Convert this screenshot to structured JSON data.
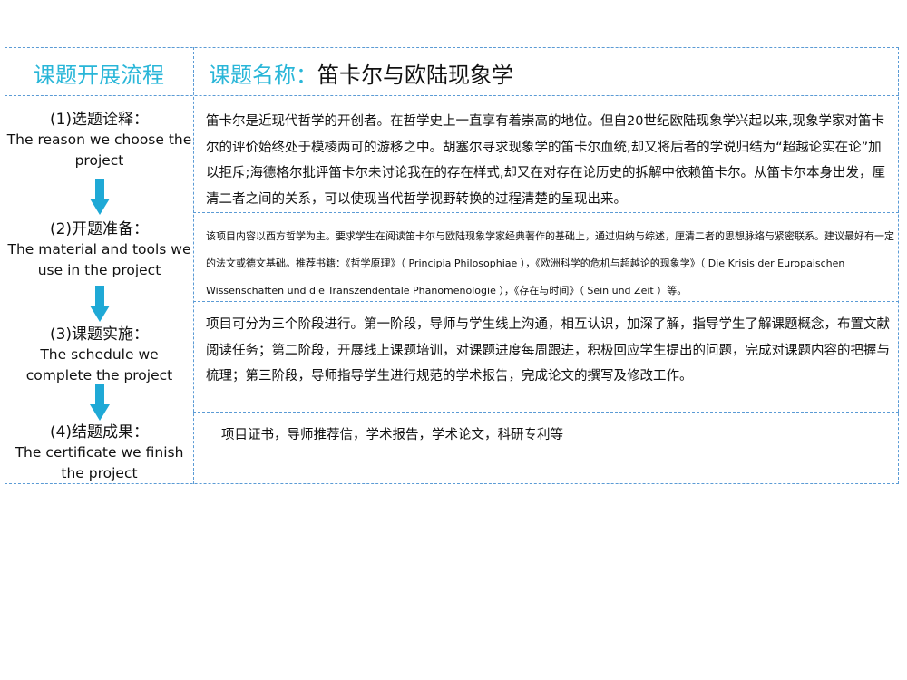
{
  "header": {
    "left_title": "课题开展流程",
    "right_label": "课题名称：",
    "right_title": "笛卡尔与欧陆现象学"
  },
  "steps": [
    {
      "cn": "(1)选题诠释：",
      "en": "The reason we choose the project"
    },
    {
      "cn": "(2)开题准备：",
      "en": "The material and tools we use in the project"
    },
    {
      "cn": "(3)课题实施：",
      "en": "The schedule we complete the project"
    },
    {
      "cn": "(4)结题成果：",
      "en": "The certificate we finish the project"
    }
  ],
  "contents": [
    "笛卡尔是近现代哲学的开创者。在哲学史上一直享有着崇高的地位。但自20世纪欧陆现象学兴起以来,现象学家对笛卡尔的评价始终处于模棱两可的游移之中。胡塞尔寻求现象学的笛卡尔血统,却又将后者的学说归结为“超越论实在论”加以拒斥;海德格尔批评笛卡尔未讨论我在的存在样式,却又在对存在论历史的拆解中依赖笛卡尔。从笛卡尔本身出发，厘清二者之间的关系，可以使现当代哲学视野转换的过程清楚的呈现出来。",
    "该项目内容以西方哲学为主。要求学生在阅读笛卡尔与欧陆现象学家经典著作的基础上，通过归纳与综述，厘清二者的思想脉络与紧密联系。建议最好有一定的法文或德文基础。推荐书籍：《哲学原理》（ Principia Philosophiae ），《欧洲科学的危机与超越论的现象学》（  Die Krisis der Europaischen Wissenschaften und die Transzendentale Phanomenologie ），《存在与时间》（ Sein und Zeit ）等。",
    "项目可分为三个阶段进行。第一阶段，导师与学生线上沟通，相互认识，加深了解，指导学生了解课题概念，布置文献阅读任务；第二阶段，开展线上课题培训，对课题进度每周跟进，积极回应学生提出的问题，完成对课题内容的把握与梳理；第三阶段，导师指导学生进行规范的学术报告，完成论文的撰写及修改工作。",
    "项目证书，导师推荐信，学术报告，学术论文，科研专利等"
  ],
  "colors": {
    "accent": "#29b6d8",
    "border": "#5b9bd5",
    "arrow": "#1fa9d6"
  },
  "icons": [
    "arrow-down-icon"
  ]
}
